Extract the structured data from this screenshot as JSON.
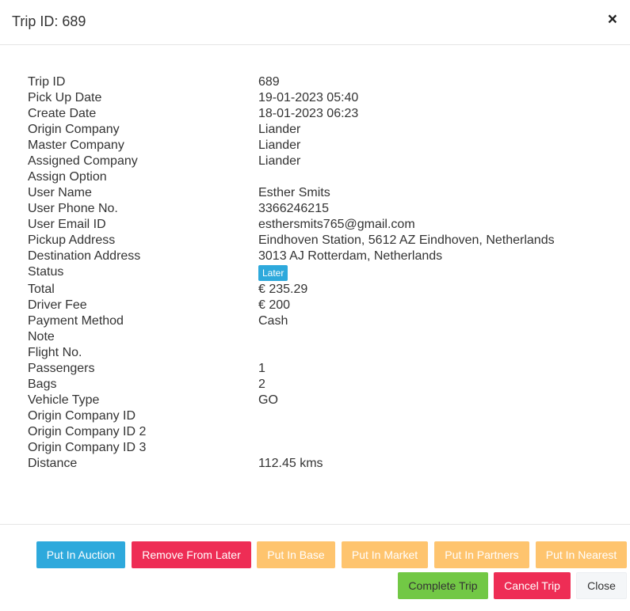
{
  "header": {
    "title": "Trip ID: 689",
    "close_symbol": "×"
  },
  "details": [
    {
      "label": "Trip ID",
      "value": "689"
    },
    {
      "label": "Pick Up Date",
      "value": "19-01-2023 05:40"
    },
    {
      "label": "Create Date",
      "value": "18-01-2023 06:23"
    },
    {
      "label": "Origin Company",
      "value": "Liander"
    },
    {
      "label": "Master Company",
      "value": "Liander"
    },
    {
      "label": "Assigned Company",
      "value": "Liander"
    },
    {
      "label": "Assign Option",
      "value": ""
    },
    {
      "label": "User Name",
      "value": "Esther Smits"
    },
    {
      "label": "User Phone No.",
      "value": "3366246215"
    },
    {
      "label": "User Email ID",
      "value": "esthersmits765@gmail.com"
    },
    {
      "label": "Pickup Address",
      "value": "Eindhoven Station, 5612 AZ Eindhoven, Netherlands"
    },
    {
      "label": "Destination Address",
      "value": "3013 AJ Rotterdam, Netherlands"
    },
    {
      "label": "Status",
      "value": "Later"
    },
    {
      "label": "Total",
      "value": "€ 235.29"
    },
    {
      "label": "Driver Fee",
      "value": "€ 200"
    },
    {
      "label": "Payment Method",
      "value": "Cash"
    },
    {
      "label": "Note",
      "value": ""
    },
    {
      "label": "Flight No.",
      "value": ""
    },
    {
      "label": "Passengers",
      "value": "1"
    },
    {
      "label": "Bags",
      "value": "2"
    },
    {
      "label": "Vehicle Type",
      "value": "GO"
    },
    {
      "label": "Origin Company ID",
      "value": ""
    },
    {
      "label": "Origin Company ID 2",
      "value": ""
    },
    {
      "label": "Origin Company ID 3",
      "value": ""
    },
    {
      "label": "Distance",
      "value": "112.45 kms"
    }
  ],
  "footer": {
    "put_in_auction": "Put In Auction",
    "remove_from_later": "Remove From Later",
    "put_in_base": "Put In Base",
    "put_in_market": "Put In Market",
    "put_in_partners": "Put In Partners",
    "put_in_nearest": "Put In Nearest",
    "complete_trip": "Complete Trip",
    "cancel_trip": "Cancel Trip",
    "close": "Close"
  },
  "colors": {
    "info": "#2ea9dc",
    "danger": "#ee2d55",
    "warning": "#fec46e",
    "success": "#72c845",
    "status_badge": "#2ea9dc"
  },
  "icons": {
    "close": "close-icon"
  }
}
